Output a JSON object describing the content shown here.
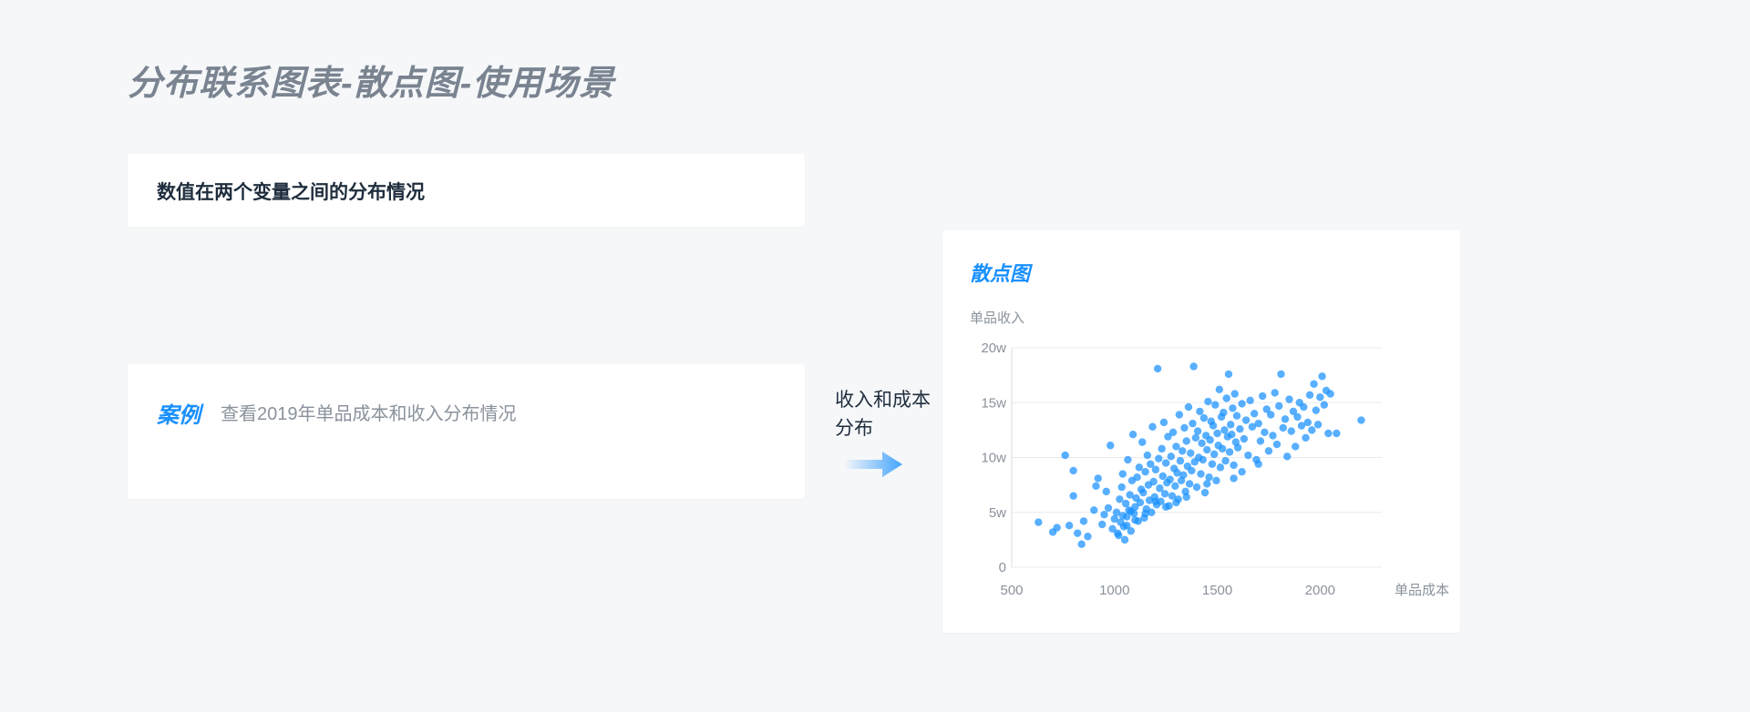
{
  "page": {
    "title": "分布联系图表-散点图-使用场景",
    "description": "数值在两个变量之间的分布情况",
    "case_label": "案例",
    "case_text": "查看2019年单品成本和收入分布情况",
    "flow_label": "收入和成本分布"
  },
  "colors": {
    "accent": "#1890ff",
    "point": "#1890ff",
    "grid": "#e8ebef",
    "axis_text": "#8a929c"
  },
  "chart_data": {
    "type": "scatter",
    "title": "散点图",
    "xlabel": "单品成本",
    "ylabel": "单品收入",
    "xlim": [
      500,
      2300
    ],
    "ylim": [
      0,
      20
    ],
    "x_ticks": [
      500,
      1000,
      1500,
      2000
    ],
    "x_tick_labels": [
      "500",
      "1000",
      "1500",
      "2000"
    ],
    "y_ticks": [
      0,
      5,
      10,
      15,
      20
    ],
    "y_tick_labels": [
      "0",
      "5w",
      "10w",
      "15w",
      "20w"
    ],
    "grid": true,
    "points": [
      [
        630,
        4.1
      ],
      [
        700,
        3.2
      ],
      [
        720,
        3.6
      ],
      [
        760,
        10.2
      ],
      [
        780,
        3.8
      ],
      [
        800,
        6.5
      ],
      [
        800,
        8.8
      ],
      [
        820,
        3.1
      ],
      [
        840,
        2.1
      ],
      [
        850,
        4.2
      ],
      [
        870,
        2.8
      ],
      [
        900,
        5.2
      ],
      [
        910,
        7.4
      ],
      [
        920,
        8.1
      ],
      [
        940,
        3.9
      ],
      [
        950,
        4.8
      ],
      [
        960,
        6.9
      ],
      [
        970,
        5.4
      ],
      [
        980,
        11.1
      ],
      [
        990,
        3.5
      ],
      [
        1000,
        4.4
      ],
      [
        1010,
        5.0
      ],
      [
        1015,
        3.1
      ],
      [
        1020,
        2.9
      ],
      [
        1025,
        6.2
      ],
      [
        1030,
        4.1
      ],
      [
        1035,
        7.3
      ],
      [
        1040,
        8.5
      ],
      [
        1045,
        3.7
      ],
      [
        1050,
        2.5
      ],
      [
        1055,
        5.8
      ],
      [
        1060,
        4.6
      ],
      [
        1065,
        9.8
      ],
      [
        1070,
        5.2
      ],
      [
        1075,
        6.6
      ],
      [
        1080,
        3.3
      ],
      [
        1085,
        7.9
      ],
      [
        1090,
        12.1
      ],
      [
        1095,
        4.9
      ],
      [
        1100,
        5.5
      ],
      [
        1105,
        6.3
      ],
      [
        1110,
        8.2
      ],
      [
        1115,
        4.2
      ],
      [
        1120,
        9.1
      ],
      [
        1125,
        5.9
      ],
      [
        1130,
        7.1
      ],
      [
        1135,
        11.4
      ],
      [
        1140,
        6.8
      ],
      [
        1145,
        4.5
      ],
      [
        1150,
        8.7
      ],
      [
        1155,
        5.3
      ],
      [
        1160,
        10.2
      ],
      [
        1165,
        7.5
      ],
      [
        1170,
        6.1
      ],
      [
        1175,
        9.4
      ],
      [
        1180,
        5.0
      ],
      [
        1185,
        12.8
      ],
      [
        1190,
        7.8
      ],
      [
        1195,
        6.4
      ],
      [
        1200,
        8.9
      ],
      [
        1205,
        5.7
      ],
      [
        1210,
        18.1
      ],
      [
        1215,
        9.9
      ],
      [
        1220,
        7.2
      ],
      [
        1225,
        6.0
      ],
      [
        1230,
        10.8
      ],
      [
        1235,
        8.3
      ],
      [
        1240,
        13.2
      ],
      [
        1245,
        6.7
      ],
      [
        1250,
        9.5
      ],
      [
        1255,
        7.7
      ],
      [
        1260,
        11.9
      ],
      [
        1265,
        5.6
      ],
      [
        1270,
        8.0
      ],
      [
        1275,
        10.1
      ],
      [
        1280,
        6.5
      ],
      [
        1285,
        12.3
      ],
      [
        1290,
        9.0
      ],
      [
        1295,
        7.4
      ],
      [
        1300,
        11.0
      ],
      [
        1305,
        8.6
      ],
      [
        1310,
        6.2
      ],
      [
        1315,
        13.9
      ],
      [
        1320,
        9.7
      ],
      [
        1325,
        7.9
      ],
      [
        1330,
        10.6
      ],
      [
        1335,
        8.4
      ],
      [
        1340,
        12.7
      ],
      [
        1345,
        6.9
      ],
      [
        1350,
        11.5
      ],
      [
        1355,
        9.2
      ],
      [
        1360,
        14.6
      ],
      [
        1365,
        7.6
      ],
      [
        1370,
        10.4
      ],
      [
        1375,
        8.8
      ],
      [
        1380,
        13.1
      ],
      [
        1385,
        18.3
      ],
      [
        1390,
        9.6
      ],
      [
        1395,
        11.8
      ],
      [
        1400,
        7.3
      ],
      [
        1405,
        12.4
      ],
      [
        1410,
        10.0
      ],
      [
        1415,
        14.2
      ],
      [
        1420,
        8.5
      ],
      [
        1425,
        11.3
      ],
      [
        1430,
        9.8
      ],
      [
        1435,
        13.6
      ],
      [
        1440,
        6.8
      ],
      [
        1445,
        12.0
      ],
      [
        1450,
        10.7
      ],
      [
        1455,
        15.1
      ],
      [
        1460,
        8.2
      ],
      [
        1465,
        11.6
      ],
      [
        1470,
        13.3
      ],
      [
        1475,
        9.4
      ],
      [
        1480,
        12.9
      ],
      [
        1485,
        10.3
      ],
      [
        1490,
        14.8
      ],
      [
        1495,
        7.9
      ],
      [
        1500,
        12.2
      ],
      [
        1505,
        11.1
      ],
      [
        1510,
        16.2
      ],
      [
        1515,
        9.1
      ],
      [
        1520,
        13.7
      ],
      [
        1525,
        10.8
      ],
      [
        1530,
        14.1
      ],
      [
        1535,
        12.5
      ],
      [
        1540,
        9.7
      ],
      [
        1545,
        15.4
      ],
      [
        1550,
        11.9
      ],
      [
        1555,
        17.6
      ],
      [
        1560,
        10.5
      ],
      [
        1565,
        13.0
      ],
      [
        1570,
        12.1
      ],
      [
        1575,
        14.5
      ],
      [
        1580,
        9.3
      ],
      [
        1585,
        15.8
      ],
      [
        1590,
        11.4
      ],
      [
        1595,
        13.8
      ],
      [
        1600,
        10.9
      ],
      [
        1610,
        12.6
      ],
      [
        1620,
        14.9
      ],
      [
        1630,
        11.7
      ],
      [
        1640,
        13.4
      ],
      [
        1650,
        10.2
      ],
      [
        1660,
        15.2
      ],
      [
        1670,
        12.8
      ],
      [
        1680,
        14.0
      ],
      [
        1690,
        9.8
      ],
      [
        1700,
        13.1
      ],
      [
        1710,
        11.5
      ],
      [
        1720,
        15.6
      ],
      [
        1730,
        12.3
      ],
      [
        1740,
        14.4
      ],
      [
        1750,
        10.6
      ],
      [
        1760,
        13.9
      ],
      [
        1770,
        12.0
      ],
      [
        1780,
        15.9
      ],
      [
        1790,
        11.2
      ],
      [
        1800,
        14.7
      ],
      [
        1810,
        17.6
      ],
      [
        1820,
        12.7
      ],
      [
        1830,
        13.5
      ],
      [
        1840,
        10.1
      ],
      [
        1850,
        15.3
      ],
      [
        1860,
        12.4
      ],
      [
        1870,
        14.2
      ],
      [
        1880,
        11.0
      ],
      [
        1890,
        13.7
      ],
      [
        1900,
        15.0
      ],
      [
        1910,
        12.9
      ],
      [
        1920,
        14.6
      ],
      [
        1930,
        11.8
      ],
      [
        1940,
        13.2
      ],
      [
        1950,
        15.7
      ],
      [
        1960,
        12.5
      ],
      [
        1970,
        16.7
      ],
      [
        1980,
        14.3
      ],
      [
        1990,
        13.0
      ],
      [
        2000,
        15.5
      ],
      [
        2010,
        17.4
      ],
      [
        2020,
        14.8
      ],
      [
        2030,
        16.1
      ],
      [
        2040,
        12.2
      ],
      [
        2050,
        15.8
      ],
      [
        2200,
        13.4
      ],
      [
        2080,
        12.2
      ],
      [
        1620,
        8.7
      ],
      [
        1700,
        9.4
      ],
      [
        1580,
        8.1
      ],
      [
        1450,
        7.6
      ],
      [
        1350,
        6.4
      ],
      [
        1300,
        5.9
      ],
      [
        1250,
        5.5
      ],
      [
        1200,
        6.0
      ],
      [
        1150,
        4.9
      ],
      [
        1100,
        4.3
      ],
      [
        1080,
        5.1
      ],
      [
        1060,
        3.8
      ],
      [
        1040,
        4.7
      ]
    ]
  }
}
